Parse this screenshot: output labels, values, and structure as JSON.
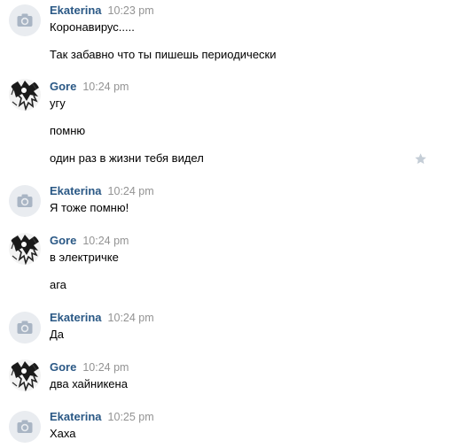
{
  "colors": {
    "author": "#2a5885",
    "time": "#939393",
    "text": "#000000",
    "camera_bg": "#e9ecf0",
    "camera_icon": "#a9b5c4",
    "star": "#c4cdd6"
  },
  "messages": [
    {
      "author": "Ekaterina",
      "avatar": "camera-icon",
      "time": "10:23 pm",
      "lines": [
        "Коронавирус.....",
        "Так забавно что ты пишешь периодически"
      ]
    },
    {
      "author": "Gore",
      "avatar": "ink-drawing-avatar",
      "time": "10:24 pm",
      "lines": [
        "угу",
        "помню",
        "один раз в жизни тебя видел"
      ],
      "starred_line_icon": "star-icon"
    },
    {
      "author": "Ekaterina",
      "avatar": "camera-icon",
      "time": "10:24 pm",
      "lines": [
        "Я тоже помню!"
      ]
    },
    {
      "author": "Gore",
      "avatar": "ink-drawing-avatar",
      "time": "10:24 pm",
      "lines": [
        "в электричке",
        "ага"
      ]
    },
    {
      "author": "Ekaterina",
      "avatar": "camera-icon",
      "time": "10:24 pm",
      "lines": [
        "Да"
      ]
    },
    {
      "author": "Gore",
      "avatar": "ink-drawing-avatar",
      "time": "10:24 pm",
      "lines": [
        "два хайникена"
      ]
    },
    {
      "author": "Ekaterina",
      "avatar": "camera-icon",
      "time": "10:25 pm",
      "lines": [
        "Хаха"
      ]
    }
  ]
}
